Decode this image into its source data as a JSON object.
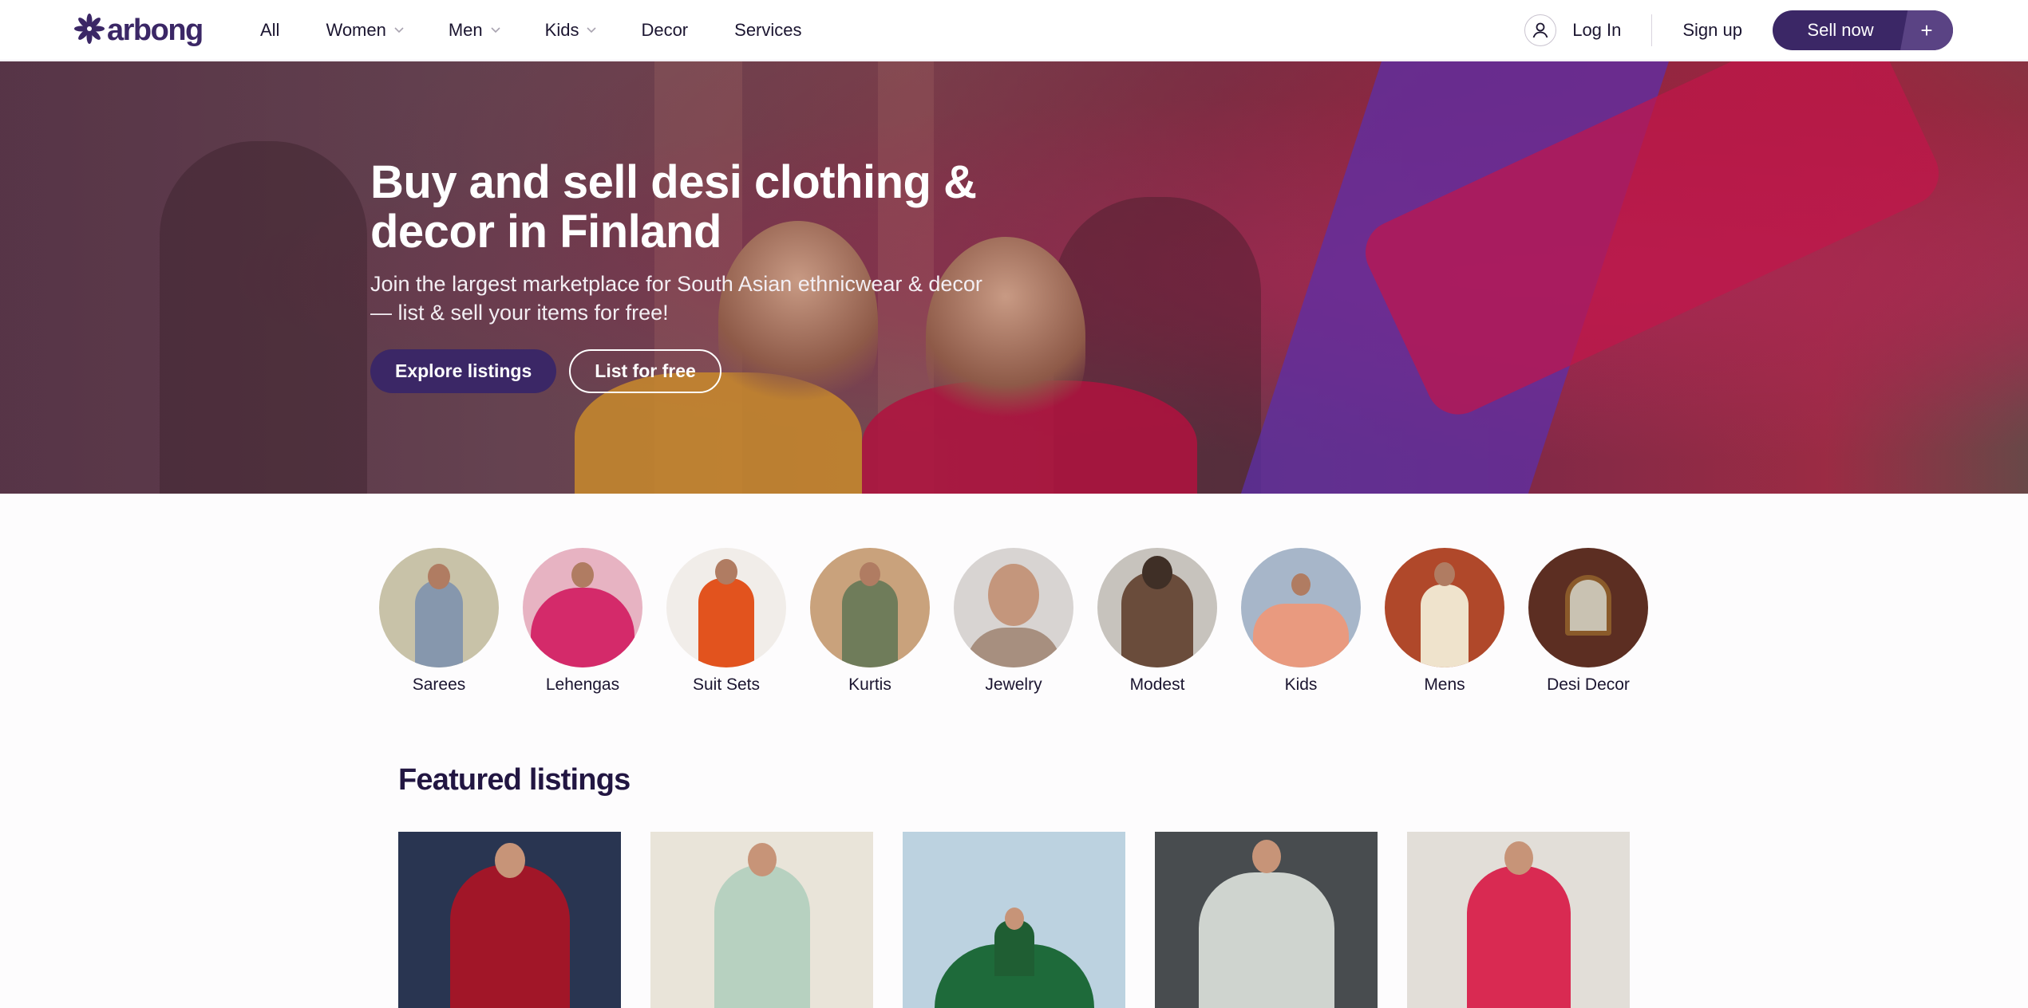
{
  "header": {
    "logo_text": "arbong",
    "nav": [
      {
        "label": "All",
        "has_dropdown": false
      },
      {
        "label": "Women",
        "has_dropdown": true
      },
      {
        "label": "Men",
        "has_dropdown": true
      },
      {
        "label": "Kids",
        "has_dropdown": true
      },
      {
        "label": "Decor",
        "has_dropdown": false
      },
      {
        "label": "Services",
        "has_dropdown": false
      }
    ],
    "login_label": "Log In",
    "signup_label": "Sign up",
    "sell_label": "Sell now",
    "sell_plus": "+",
    "user_icon": "user-icon"
  },
  "hero": {
    "title": "Buy and sell desi clothing & decor in Finland",
    "subtitle": "Join the largest marketplace for South Asian ethnicwear & decor — list & sell your items for free!",
    "primary_button": "Explore listings",
    "secondary_button": "List for free"
  },
  "categories": [
    {
      "label": "Sarees"
    },
    {
      "label": "Lehengas"
    },
    {
      "label": "Suit Sets"
    },
    {
      "label": "Kurtis"
    },
    {
      "label": "Jewelry"
    },
    {
      "label": "Modest"
    },
    {
      "label": "Kids"
    },
    {
      "label": "Mens"
    },
    {
      "label": "Desi Decor"
    }
  ],
  "featured": {
    "title": "Featured listings",
    "cards": 5
  },
  "colors": {
    "brand": "#3b2766",
    "brand_light": "#5a4384",
    "text": "#1b1530"
  }
}
